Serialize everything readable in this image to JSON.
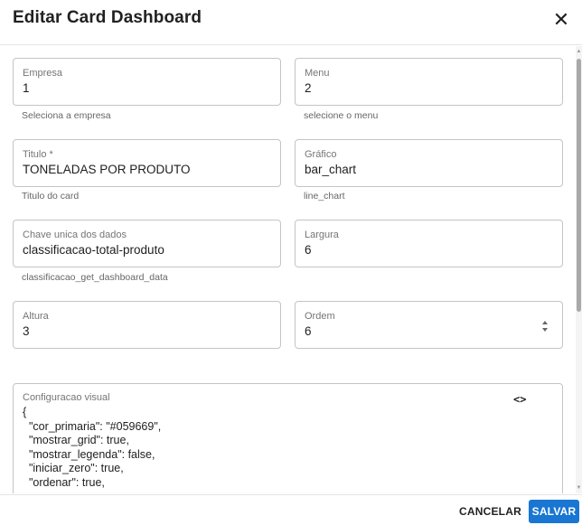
{
  "dialog": {
    "title": "Editar Card Dashboard",
    "close_icon": "close-icon"
  },
  "form": {
    "empresa": {
      "label": "Empresa",
      "value": "1",
      "hint": "Seleciona a empresa"
    },
    "menu": {
      "label": "Menu",
      "value": "2",
      "hint": "selecione o menu"
    },
    "titulo": {
      "label": "Titulo *",
      "value": "TONELADAS POR PRODUTO",
      "hint": "Titulo do card"
    },
    "grafico": {
      "label": "Gráfico",
      "value": "bar_chart",
      "hint": "line_chart"
    },
    "chave": {
      "label": "Chave unica dos dados",
      "value": "classificacao-total-produto",
      "hint": "classificacao_get_dashboard_data"
    },
    "largura": {
      "label": "Largura",
      "value": "6"
    },
    "altura": {
      "label": "Altura",
      "value": "3"
    },
    "ordem": {
      "label": "Ordem",
      "value": "6"
    },
    "config": {
      "label": "Configuracao visual",
      "code_icon": "code-icon",
      "text": "{\n  \"cor_primaria\": \"#059669\",\n  \"mostrar_grid\": true,\n  \"mostrar_legenda\": false,\n  \"iniciar_zero\": true,\n  \"ordenar\": true,"
    }
  },
  "actions": {
    "cancel_label": "CANCELAR",
    "save_label": "SALVAR"
  },
  "colors": {
    "primary": "#1976d2",
    "border": "#c4c4c4"
  }
}
